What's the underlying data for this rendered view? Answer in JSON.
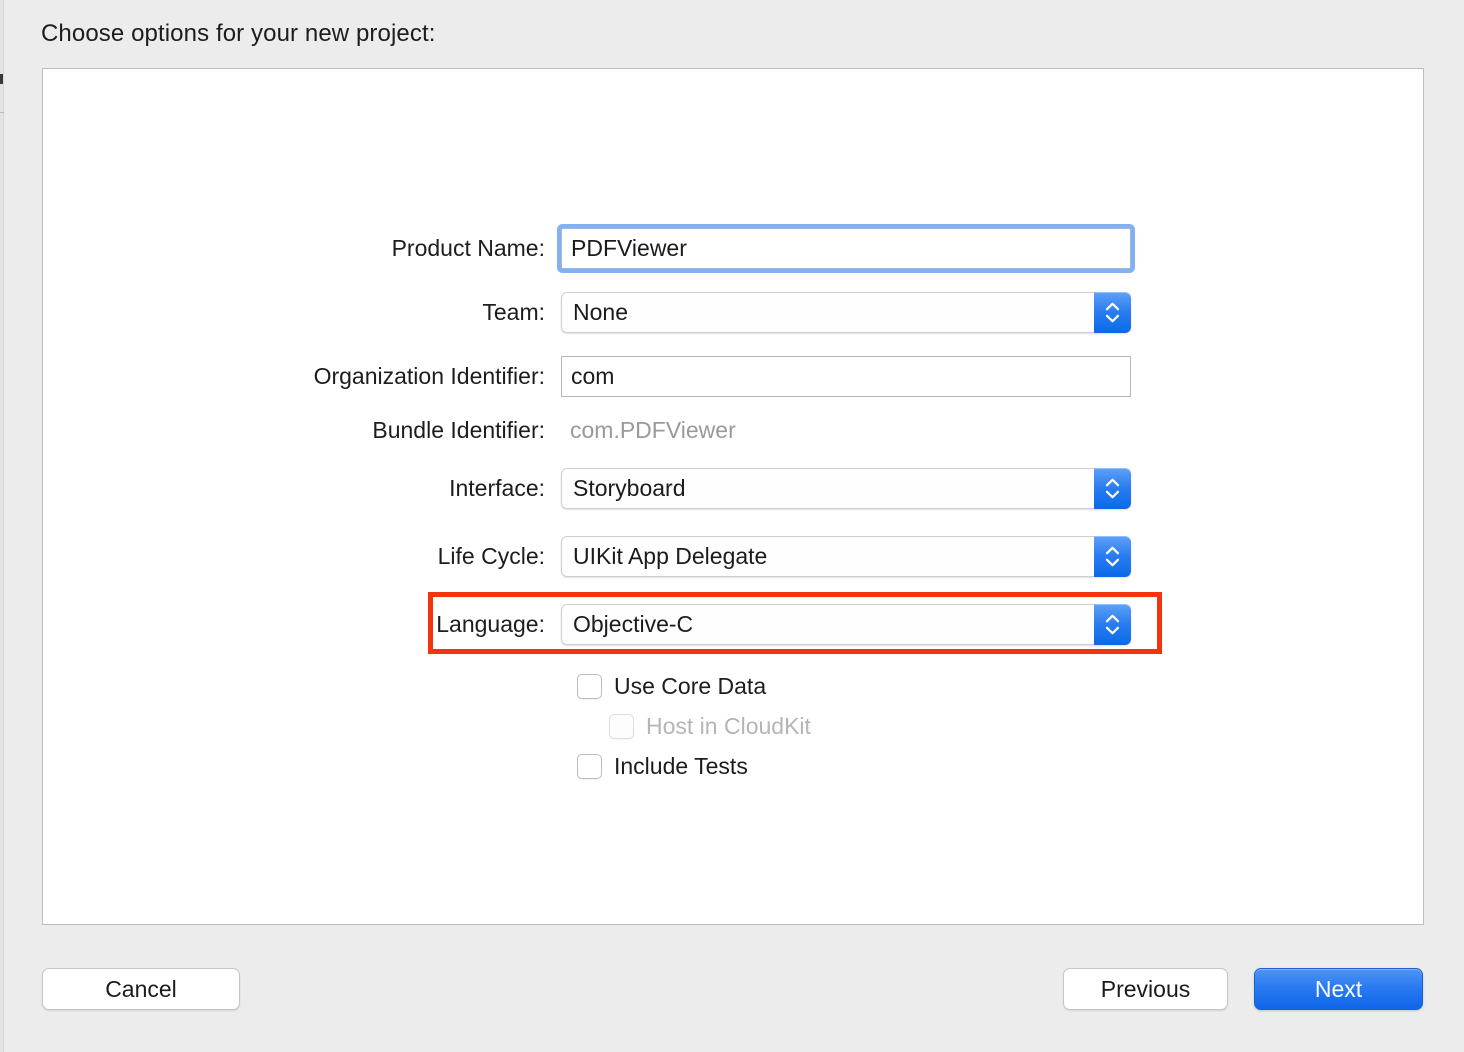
{
  "window": {
    "title": "Choose options for your new project:"
  },
  "form": {
    "fields": [
      {
        "label": "Product Name:",
        "value": "PDFViewer",
        "kind": "text",
        "focused": true
      },
      {
        "label": "Team:",
        "value": "None",
        "kind": "popup"
      },
      {
        "label": "Organization Identifier:",
        "value": "com",
        "kind": "text",
        "focused": false
      },
      {
        "label": "Bundle Identifier:",
        "value": "com.PDFViewer",
        "kind": "static"
      },
      {
        "label": "Interface:",
        "value": "Storyboard",
        "kind": "popup"
      },
      {
        "label": "Life Cycle:",
        "value": "UIKit App Delegate",
        "kind": "popup"
      },
      {
        "label": "Language:",
        "value": "Objective-C",
        "kind": "popup",
        "highlighted": true
      }
    ],
    "checkboxes": [
      {
        "label": "Use Core Data",
        "checked": false,
        "disabled": false
      },
      {
        "label": "Host in CloudKit",
        "checked": false,
        "disabled": true
      },
      {
        "label": "Include Tests",
        "checked": false,
        "disabled": false
      }
    ]
  },
  "footer": {
    "cancel_label": "Cancel",
    "previous_label": "Previous",
    "next_label": "Next"
  },
  "icons": {
    "stepper_up": "chevron-up-icon",
    "stepper_down": "chevron-down-icon"
  },
  "colors": {
    "accent_blue": "#2a7bf2",
    "annotation_red": "#f5330e",
    "background": "#ececec",
    "panel": "#ffffff",
    "disabled_text": "#b5b5b5"
  }
}
